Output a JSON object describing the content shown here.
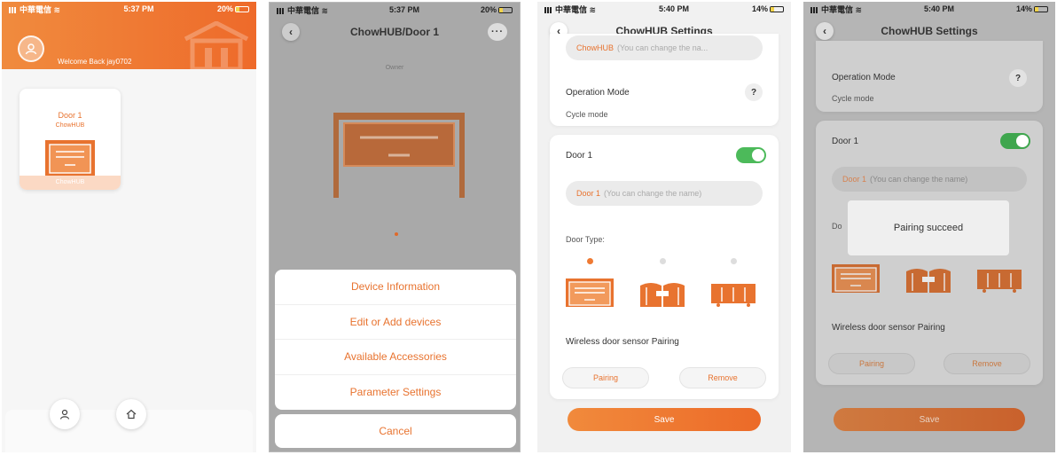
{
  "colors": {
    "accent": "#e8732f",
    "toggle_on": "#4cba5a"
  },
  "screen1": {
    "status": {
      "carrier": "中華電信",
      "time": "5:37 PM",
      "battery": "20%"
    },
    "welcome": "Welcome Back jay0702",
    "device_card": {
      "name": "Door 1",
      "sub": "ChowHUB",
      "band": "ChowHUB"
    },
    "bottom_icons": [
      "user-icon",
      "home-icon"
    ]
  },
  "screen2": {
    "status": {
      "carrier": "中華電信",
      "time": "5:37 PM",
      "battery": "20%"
    },
    "title": "ChowHUB/Door 1",
    "more": "···",
    "owner": "Owner",
    "menu": [
      "Device Information",
      "Edit or Add devices",
      "Available Accessories",
      "Parameter Settings"
    ],
    "cancel": "Cancel"
  },
  "screen3": {
    "status": {
      "carrier": "中華電信",
      "time": "5:40 PM",
      "battery": "14%"
    },
    "title": "ChowHUB Settings",
    "hub_name_input": {
      "value": "ChowHUB",
      "hint": "(You can change the na..."
    },
    "operation_mode_label": "Operation Mode",
    "operation_mode_value": "Cycle mode",
    "help": "?",
    "door_title": "Door 1",
    "door_name_input": {
      "value": "Door 1",
      "hint": "(You can change the name)"
    },
    "door_type_label": "Door Type:",
    "sensor_label": "Wireless door sensor Pairing",
    "pairing": "Pairing",
    "remove": "Remove",
    "save": "Save"
  },
  "screen4": {
    "status": {
      "carrier": "中華電信",
      "time": "5:40 PM",
      "battery": "14%"
    },
    "title": "ChowHUB Settings",
    "operation_mode_label": "Operation Mode",
    "operation_mode_value": "Cycle mode",
    "help": "?",
    "door_title": "Door 1",
    "door_name_input": {
      "value": "Door 1",
      "hint": "(You can change the name)"
    },
    "door_type_label": "Do",
    "sensor_label": "Wireless door sensor Pairing",
    "pairing": "Pairing",
    "remove": "Remove",
    "save": "Save",
    "toast": "Pairing succeed"
  }
}
